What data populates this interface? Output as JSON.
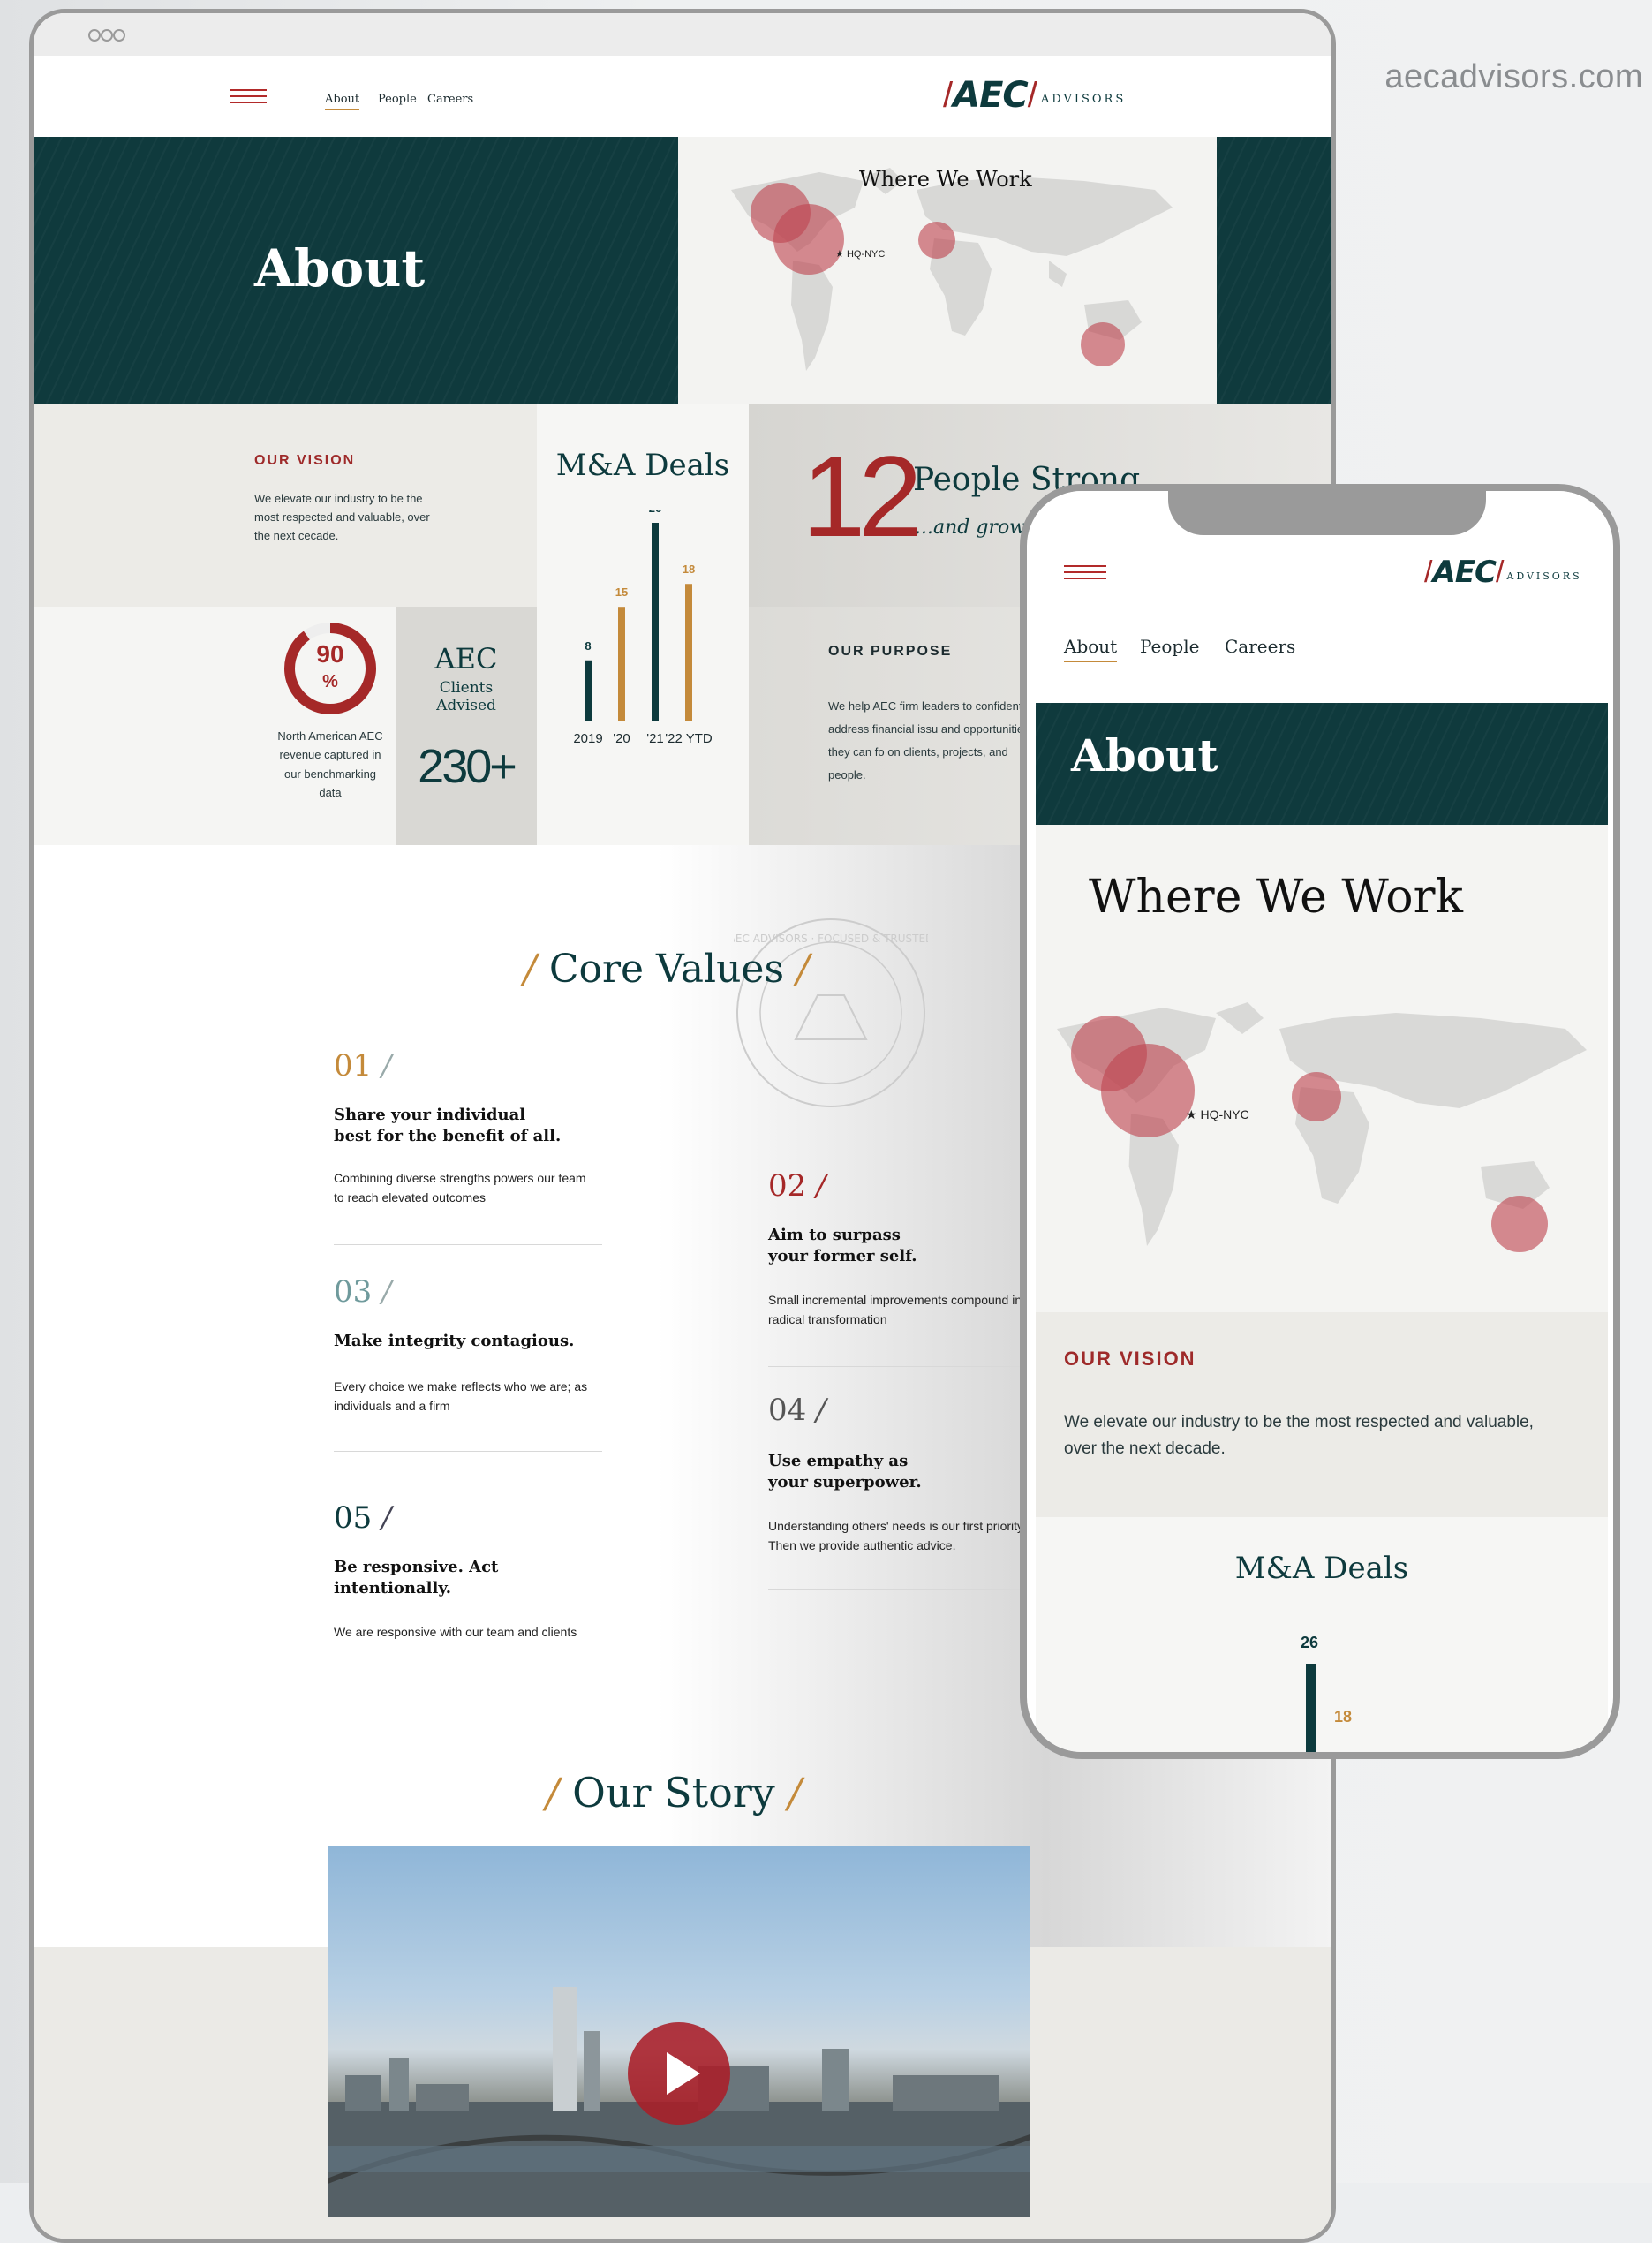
{
  "site_url": "aecadvisors.com",
  "brand": {
    "aec": "AEC",
    "advisors": "ADVISORS"
  },
  "nav": {
    "about": "About",
    "people": "People",
    "careers": "Careers"
  },
  "hero": {
    "title": "About"
  },
  "map": {
    "title": "Where We Work",
    "hq_label": "HQ-NYC"
  },
  "vision": {
    "label": "OUR VISION",
    "text_desktop": "We elevate our industry to be the most respected and valuable, over the next cecade.",
    "text_mobile": "We elevate our industry to be the most respected and valuable, over the next decade."
  },
  "stats": {
    "percent_value": "90",
    "percent_sign": "%",
    "percent_fill": 0.9,
    "percent_caption": "North American AEC revenue captured in our benchmarking data",
    "clients_title": "AEC",
    "clients_sub": "Clients Advised",
    "clients_value": "230+",
    "people_number": "12",
    "people_title": "People Strong",
    "people_sub": "...and grow"
  },
  "chart_data": {
    "type": "bar",
    "title": "M&A Deals",
    "categories": [
      "2019",
      "'20",
      "'21",
      "'22 YTD"
    ],
    "values": [
      8,
      15,
      26,
      18
    ],
    "colors": [
      "#0d3a3d",
      "#c48a3a",
      "#0d3a3d",
      "#c48a3a"
    ],
    "label_colors": [
      "#0d3a3d",
      "#c48a3a",
      "#0d3a3d",
      "#c48a3a"
    ]
  },
  "purpose": {
    "label": "OUR PURPOSE",
    "text": "We help AEC firm leaders to confidently address financial issu and opportunities, so they can fo on clients, projects, and people."
  },
  "seal": {
    "text": "AEC ADVISORS · FOCUSED & TRUSTED"
  },
  "core_values": {
    "title": "Core Values",
    "items": [
      {
        "num": "01",
        "title": "Share your individual best for the benefit of all.",
        "desc": "Combining diverse strengths powers our team to reach elevated outcomes"
      },
      {
        "num": "02",
        "title": "Aim to surpass your former self.",
        "desc": "Small incremental improvements compound into radical transformation"
      },
      {
        "num": "03",
        "title": "Make integrity contagious.",
        "desc": "Every choice we make reflects who we are; as individuals and a firm"
      },
      {
        "num": "04",
        "title": "Use empathy as your superpower.",
        "desc": "Understanding others' needs is our first priority. Then we provide authentic advice."
      },
      {
        "num": "05",
        "title": "Be responsive. Act intentionally.",
        "desc": "We are responsive with our team and clients"
      }
    ]
  },
  "story": {
    "title": "Our Story"
  },
  "mobile_chart": {
    "top_value": "26",
    "next_value": "18"
  },
  "colors": {
    "teal": "#0f3a3d",
    "red": "#a52828",
    "gold": "#c48a3a",
    "bubble": "#be4650"
  }
}
